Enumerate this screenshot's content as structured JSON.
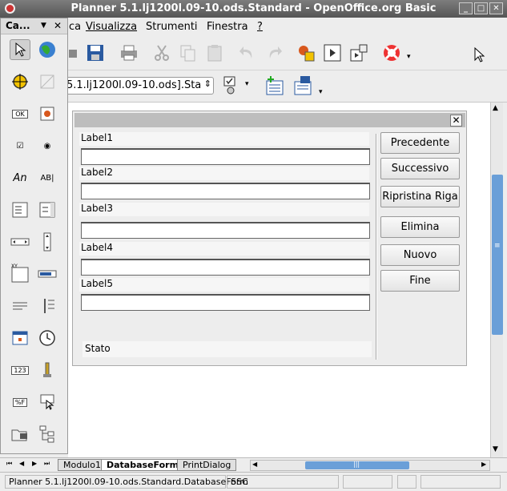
{
  "window": {
    "title": "Planner 5.1.lj1200l.09-10.ods.Standard - OpenOffice.org Basic",
    "minimize": "_",
    "maximize": "□",
    "close": "✕"
  },
  "menu": {
    "partial": "ca",
    "items": [
      "Visualizza",
      "Strumenti",
      "Finestra",
      "?"
    ]
  },
  "palette": {
    "title": "Ca...",
    "dropdown": "▼",
    "close": "✕",
    "icons": [
      "select-pointer",
      "globe-test",
      "crosshair",
      "disabled-properties",
      "ok-button",
      "image-control",
      "checkbox",
      "radio-button",
      "label-text",
      "text-field",
      "list-box",
      "combo-box",
      "horizontal-scrollbar",
      "vertical-scrollbar",
      "group-box",
      "progress-bar",
      "horizontal-line",
      "vertical-line",
      "date-field",
      "time-field",
      "numeric-field",
      "currency-field",
      "formatted-field",
      "pattern-field",
      "file-control",
      "tree-control"
    ],
    "glyphs": {
      "ok": "OK",
      "text_field": "AB|",
      "label": "An",
      "checkbox": "☑",
      "radio": "◉",
      "numeric": "123",
      "formatted": "%F",
      "xy": "XY"
    }
  },
  "toolbar": {
    "library_combo": "5.1.lj1200l.09-10.ods].Sta",
    "combo_arrow": "⇕",
    "overflow": "▾"
  },
  "dialog": {
    "close": "✕",
    "labels": [
      "Label1",
      "Label2",
      "Label3",
      "Label4",
      "Label5"
    ],
    "fields": [
      "",
      "",
      "",
      "",
      ""
    ],
    "buttons": [
      "Precedente",
      "Successivo",
      "Ripristina Riga",
      "Elimina",
      "Nuovo",
      "Fine"
    ],
    "status_label": "Stato"
  },
  "tabs": {
    "nav": [
      "⏮",
      "◀",
      "▶",
      "⏭"
    ],
    "items": [
      "Modulo1",
      "DatabaseForm",
      "PrintDialog"
    ],
    "active": "DatabaseForm"
  },
  "statusbar": {
    "location": "Planner 5.1.lj1200l.09-10.ods.Standard.DatabaseForm",
    "mode": "SSC"
  },
  "scroll": {
    "up": "▲",
    "down": "▼",
    "left": "◀",
    "right": "▶",
    "grip_v": "≡",
    "grip_h": "|||"
  },
  "colors": {
    "titlebar": "#666666",
    "scroll_thumb": "#6a9fd8",
    "dialog_bg": "#ededed"
  }
}
